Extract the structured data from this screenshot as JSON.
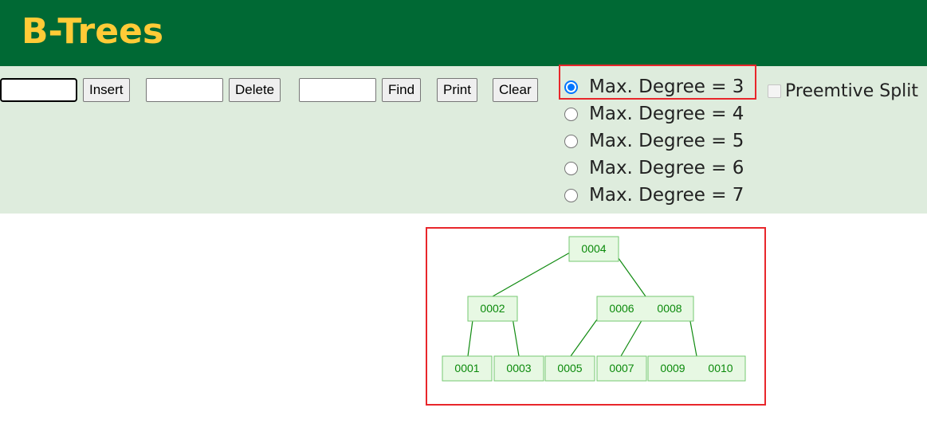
{
  "header": {
    "title": "B-Trees"
  },
  "controls": {
    "insert_input": {
      "value": ""
    },
    "insert_label": "Insert",
    "delete_input": {
      "value": ""
    },
    "delete_label": "Delete",
    "find_input": {
      "value": ""
    },
    "find_label": "Find",
    "print_label": "Print",
    "clear_label": "Clear",
    "degree_options": [
      {
        "label": "Max. Degree = 3",
        "checked": true
      },
      {
        "label": "Max. Degree = 4",
        "checked": false
      },
      {
        "label": "Max. Degree = 5",
        "checked": false
      },
      {
        "label": "Max. Degree = 6",
        "checked": false
      },
      {
        "label": "Max. Degree = 7",
        "checked": false
      }
    ],
    "preemptive_split": {
      "label": "Preemtive Split",
      "checked": false
    }
  },
  "tree": {
    "root": {
      "keys": [
        "0004"
      ]
    },
    "level1": [
      {
        "keys": [
          "0002"
        ]
      },
      {
        "keys": [
          "0006",
          "0008"
        ]
      }
    ],
    "leaves": [
      {
        "keys": [
          "0001"
        ]
      },
      {
        "keys": [
          "0003"
        ]
      },
      {
        "keys": [
          "0005"
        ]
      },
      {
        "keys": [
          "0007"
        ]
      },
      {
        "keys": [
          "0009",
          "0010"
        ]
      }
    ]
  },
  "colors": {
    "header_bg": "#006934",
    "title": "#ffcb37",
    "controls_bg": "#deecdd",
    "node_fill": "#e7f8e3",
    "node_stroke": "#76c972",
    "edge": "#118b11",
    "highlight": "#e8262b",
    "radio_accent": "#0075ff"
  }
}
